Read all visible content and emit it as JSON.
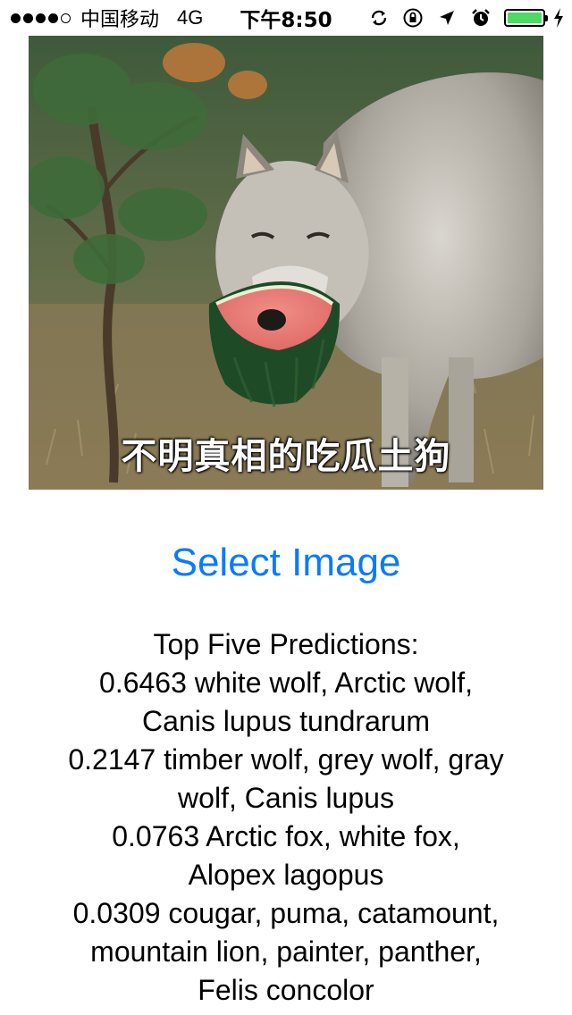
{
  "status_bar": {
    "signal_filled": 4,
    "signal_total": 5,
    "carrier": "中国移动",
    "network": "4G",
    "time": "下午8:50",
    "icons": [
      "rotation-lock-icon",
      "orientation-lock-icon",
      "location-arrow-icon",
      "alarm-icon",
      "battery-icon",
      "charging-bolt-icon"
    ],
    "battery_level": 1.0,
    "battery_color": "#4cd964"
  },
  "photo": {
    "caption": "不明真相的吃瓜土狗"
  },
  "select_button": {
    "label": "Select Image",
    "color": "#0a7aff"
  },
  "predictions": {
    "title": "Top Five Predictions:",
    "lines": [
      "0.6463 white wolf, Arctic wolf,",
      "Canis lupus tundrarum",
      "0.2147 timber wolf, grey wolf, gray",
      "wolf, Canis lupus",
      "0.0763 Arctic fox, white fox,",
      "Alopex lagopus",
      "0.0309 cougar, puma, catamount,",
      "mountain lion, painter, panther,",
      "Felis concolor"
    ]
  }
}
